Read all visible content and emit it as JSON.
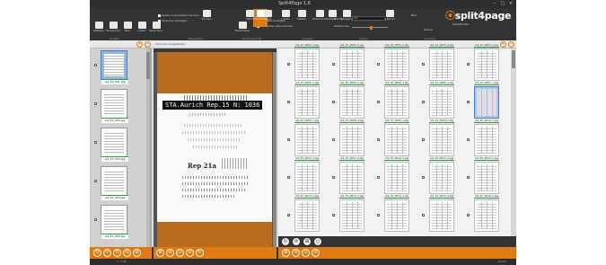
{
  "window": {
    "title": "Split4Page 1.6",
    "controls": [
      "–",
      "□",
      "✕"
    ]
  },
  "logo": {
    "prefix": "",
    "brand": "split4page",
    "accent": "#e07a12"
  },
  "ribbon": {
    "buttons": [
      {
        "label": "Dateien",
        "icon": "folder-icon"
      },
      {
        "label": "Verzeichnis",
        "icon": "folder-tree-icon"
      },
      {
        "label": "Neu",
        "icon": "new-icon"
      },
      {
        "label": "Laden",
        "icon": "open-icon"
      },
      {
        "label": "Speichern",
        "icon": "save-icon"
      },
      {
        "label": "Exportieren",
        "icon": "export-icon"
      },
      {
        "label": "Einstellungen",
        "icon": "settings-icon"
      },
      {
        "label": "Suchen",
        "icon": "search-icon"
      },
      {
        "label": "Start",
        "icon": "play-icon"
      },
      {
        "label": "Stopp",
        "icon": "stop-icon"
      },
      {
        "label": "Laden",
        "icon": "load-icon"
      },
      {
        "label": "Setzen",
        "icon": "set-icon"
      },
      {
        "label": "Zuschneiden",
        "icon": "crop-icon"
      },
      {
        "label": "Drehen",
        "icon": "rotate-icon"
      },
      {
        "label": "Spiegeln",
        "icon": "mirror-icon"
      },
      {
        "label": "Trennen",
        "icon": "split-icon"
      }
    ],
    "checkboxes": [
      "Seiten automatisch trennen",
      "Vorschau anzeigen",
      "Hinweise anzeigen",
      "Alle Seiten übernehmen"
    ],
    "fields": {
      "size_label": "Zoom",
      "size_value": "5%",
      "name_label": "Dateiname",
      "name_value": "Seite"
    },
    "group_labels": [
      "Projekt",
      "Bearbeiten",
      "Bildausschnitt",
      "Ausgabe",
      "Seiten",
      "Vorschau"
    ],
    "right_labels": [
      "Bild",
      "Ordner",
      "Oberflächen"
    ]
  },
  "subbar": {
    "viewer_caption": "Vorschau Ausgabebild",
    "zoom_in": "+",
    "zoom_out": "−"
  },
  "left_thumbs": [
    {
      "caption": "rs4_15_001.jpg",
      "selected": true,
      "checked": false
    },
    {
      "caption": "rs4_15_002.jpg",
      "selected": false,
      "checked": false
    },
    {
      "caption": "rs4_15_003.jpg",
      "selected": false,
      "checked": false
    },
    {
      "caption": "rs4_15_004.jpg",
      "selected": false,
      "checked": true
    },
    {
      "caption": "rs4_15_005.jpg",
      "selected": false,
      "checked": false
    }
  ],
  "viewer": {
    "stamp": "STA.Aurich Rep.15  N: 1036",
    "handwriting_heading": "Rep 21a"
  },
  "grid": {
    "rows": [
      [
        "rs4_15_0002_1.jpg",
        "rs4_15_0002_2.jpg",
        "rs4_15_0003_1.jpg",
        "rs4_15_0003_2.jpg",
        "rs4_15_0004_1.jpg"
      ],
      [
        "rs4_15_0005_1.jpg",
        "rs4_15_0005_2.jpg",
        "rs4_15_0006_1.jpg",
        "rs4_15_0006_2.jpg",
        "rs4_15_0007_1.jpg"
      ],
      [
        "rs4_15_0008_1.jpg",
        "rs4_15_0008_2.jpg",
        "rs4_15_0009_1.jpg",
        "rs4_15_0009_2.jpg",
        "rs4_15_0010_1.jpg"
      ],
      [
        "rs4_15_0011_1.jpg",
        "rs4_15_0011_2.jpg",
        "rs4_15_0012_1.jpg",
        "rs4_15_0012_2.jpg",
        "rs4_15_0013_1.jpg"
      ],
      [
        "rs4_15_0014_1.jpg",
        "rs4_15_0014_2.jpg",
        "rs4_15_0015_1.jpg",
        "rs4_15_0015_2.jpg",
        "rs4_15_0016_1.jpg"
      ]
    ],
    "selected": [
      1,
      4
    ]
  },
  "grid_tools": [
    "↻",
    "⟳",
    "⊞",
    "○"
  ],
  "bottom_icons_left": [
    "⟲",
    "⟳",
    "⇅",
    "⇆",
    "⊕"
  ],
  "bottom_icons_mid": [
    "⊕",
    "⊖",
    "⊙",
    "⊘",
    "↻"
  ],
  "bottom_icons_right": [
    "⊕",
    "⊖",
    "⊙",
    "⊘"
  ],
  "status": {
    "left": "1 / 136",
    "right": "bereit"
  }
}
